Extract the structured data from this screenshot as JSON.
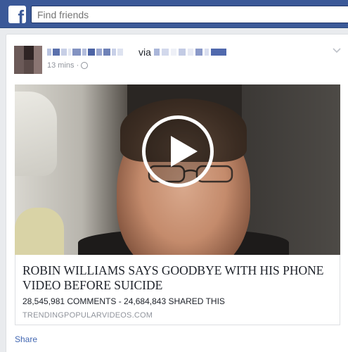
{
  "topbar": {
    "logo": "f",
    "search_placeholder": "Find friends",
    "color": "#3b5998"
  },
  "post": {
    "via_label": "via",
    "timestamp": "13 mins ·",
    "privacy_icon": "globe-icon",
    "options_icon": "chevron-down-icon",
    "video": {
      "play_icon": "play-icon"
    },
    "link": {
      "headline": "ROBIN WILLIAMS SAYS GOODBYE WITH HIS PHONE VIDEO BEFORE SUICIDE",
      "stats": "28,545,981 COMMENTS - 24,684,843 SHARED THIS",
      "domain": "TRENDINGPOPULARVIDEOS.COM"
    },
    "actions": {
      "share_label": "Share"
    }
  }
}
